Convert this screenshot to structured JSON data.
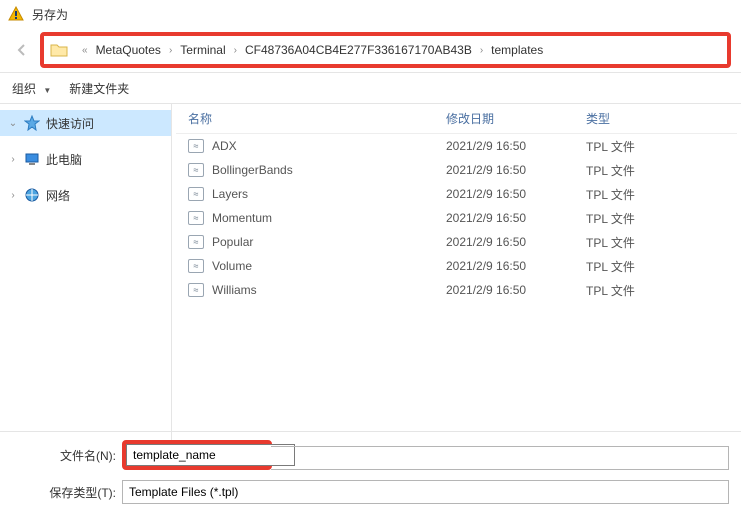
{
  "window": {
    "title": "另存为"
  },
  "breadcrumb": {
    "prefix": "«",
    "segments": [
      "MetaQuotes",
      "Terminal",
      "CF48736A04CB4E277F336167170AB43B",
      "templates"
    ]
  },
  "toolbar": {
    "organize": "组织",
    "new_folder": "新建文件夹"
  },
  "sidebar": {
    "items": [
      {
        "label": "快速访问",
        "icon": "star"
      },
      {
        "label": "此电脑",
        "icon": "pc"
      },
      {
        "label": "网络",
        "icon": "network"
      }
    ]
  },
  "list": {
    "headers": {
      "name": "名称",
      "modified": "修改日期",
      "type": "类型"
    },
    "rows": [
      {
        "name": "ADX",
        "modified": "2021/2/9 16:50",
        "type": "TPL 文件"
      },
      {
        "name": "BollingerBands",
        "modified": "2021/2/9 16:50",
        "type": "TPL 文件"
      },
      {
        "name": "Layers",
        "modified": "2021/2/9 16:50",
        "type": "TPL 文件"
      },
      {
        "name": "Momentum",
        "modified": "2021/2/9 16:50",
        "type": "TPL 文件"
      },
      {
        "name": "Popular",
        "modified": "2021/2/9 16:50",
        "type": "TPL 文件"
      },
      {
        "name": "Volume",
        "modified": "2021/2/9 16:50",
        "type": "TPL 文件"
      },
      {
        "name": "Williams",
        "modified": "2021/2/9 16:50",
        "type": "TPL 文件"
      }
    ]
  },
  "footer": {
    "filename_label": "文件名(N):",
    "filename_value": "template_name",
    "savetype_label": "保存类型(T):",
    "savetype_value": "Template Files (*.tpl)"
  }
}
